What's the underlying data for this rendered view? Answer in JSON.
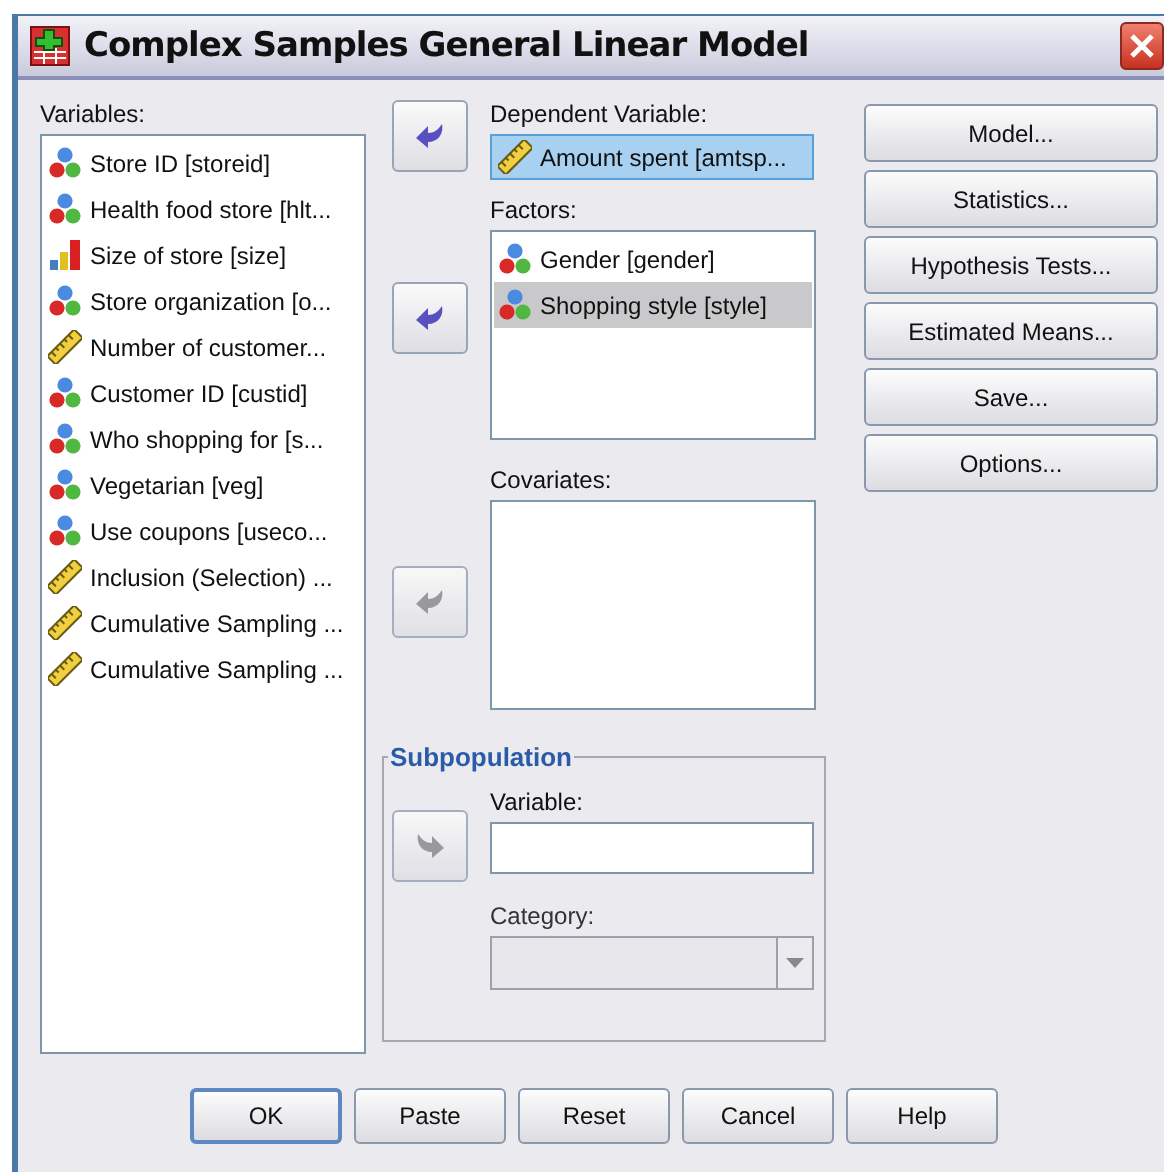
{
  "window": {
    "title": "Complex Samples General Linear Model"
  },
  "variables": {
    "label": "Variables:",
    "items": [
      {
        "name": "Store ID [storeid]",
        "kind": "nominal",
        "selected": false
      },
      {
        "name": "Health food store [hlt...",
        "kind": "nominal",
        "selected": false
      },
      {
        "name": "Size of store [size]",
        "kind": "ordinal",
        "selected": false
      },
      {
        "name": "Store organization [o...",
        "kind": "nominal",
        "selected": false
      },
      {
        "name": "Number of customer...",
        "kind": "scale",
        "selected": false
      },
      {
        "name": "Customer ID [custid]",
        "kind": "nominal",
        "selected": false
      },
      {
        "name": "Who shopping for [s...",
        "kind": "nominal",
        "selected": false
      },
      {
        "name": "Vegetarian [veg]",
        "kind": "nominal",
        "selected": false
      },
      {
        "name": "Use coupons [useco...",
        "kind": "nominal",
        "selected": false
      },
      {
        "name": "Inclusion (Selection) ...",
        "kind": "scale",
        "selected": false
      },
      {
        "name": "Cumulative Sampling ...",
        "kind": "scale",
        "selected": false
      },
      {
        "name": "Cumulative Sampling ...",
        "kind": "scale",
        "selected": false
      }
    ]
  },
  "dependent": {
    "label": "Dependent Variable:",
    "move_button": {
      "disabled": false
    },
    "value": {
      "name": "Amount spent [amtsp...",
      "kind": "scale",
      "selected": true
    }
  },
  "factors": {
    "label": "Factors:",
    "move_button": {
      "disabled": false
    },
    "items": [
      {
        "name": "Gender [gender]",
        "kind": "nominal",
        "selected": false
      },
      {
        "name": "Shopping style [style]",
        "kind": "nominal",
        "selected": true
      }
    ]
  },
  "covariates": {
    "label": "Covariates:",
    "move_button": {
      "disabled": true
    }
  },
  "subpopulation": {
    "title": "Subpopulation",
    "move_button": {
      "disabled": true
    },
    "variable": {
      "label": "Variable:"
    },
    "category": {
      "label": "Category:",
      "disabled": true
    }
  },
  "side_buttons": [
    "Model...",
    "Statistics...",
    "Hypothesis Tests...",
    "Estimated Means...",
    "Save...",
    "Options..."
  ],
  "buttons": [
    {
      "label": "OK",
      "default": true
    },
    {
      "label": "Paste",
      "default": false
    },
    {
      "label": "Reset",
      "default": false
    },
    {
      "label": "Cancel",
      "default": false
    },
    {
      "label": "Help",
      "default": false
    }
  ]
}
